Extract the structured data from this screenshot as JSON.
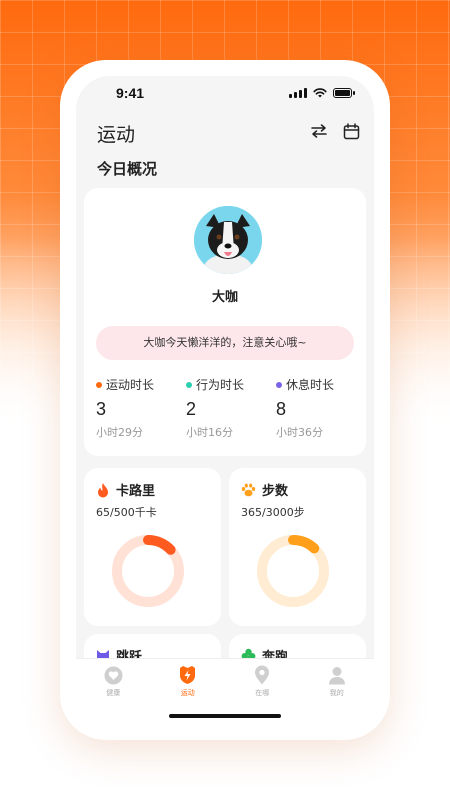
{
  "status": {
    "time": "9:41"
  },
  "header": {
    "title": "运动",
    "switch_icon": "swap-icon",
    "calendar_icon": "calendar-icon"
  },
  "overview": {
    "section_title": "今日概况",
    "pet_name": "大咖",
    "message": "大咖今天懒洋洋的，注意关心哦~",
    "stats": [
      {
        "label": "运动时长",
        "value": "3",
        "unit": "小时29分",
        "color": "#ff6a0e"
      },
      {
        "label": "行为时长",
        "value": "2",
        "unit": "小时16分",
        "color": "#2ccfb0"
      },
      {
        "label": "休息时长",
        "value": "8",
        "unit": "小时36分",
        "color": "#7b62e8"
      }
    ]
  },
  "metrics": [
    {
      "title": "卡路里",
      "sub": "65/500千卡",
      "icon": "flame-icon",
      "progress": 0.13,
      "color": "#ff5a1f",
      "track": "#ffe1d6"
    },
    {
      "title": "步数",
      "sub": "365/3000步",
      "icon": "paw-icon",
      "progress": 0.12,
      "color": "#ff9f1a",
      "track": "#ffecd2"
    },
    {
      "title": "跳跃",
      "icon": "cat-icon",
      "color": "#6d5be8"
    },
    {
      "title": "奔跑",
      "icon": "clover-icon",
      "color": "#2dbb5a"
    }
  ],
  "tabs": [
    {
      "label": "健康",
      "icon": "heart-icon"
    },
    {
      "label": "运动",
      "icon": "lightning-shield-icon"
    },
    {
      "label": "在哪",
      "icon": "location-pin-icon"
    },
    {
      "label": "我的",
      "icon": "person-icon"
    }
  ],
  "colors": {
    "accent": "#ff6a0e",
    "background": "#f5f5f5"
  }
}
